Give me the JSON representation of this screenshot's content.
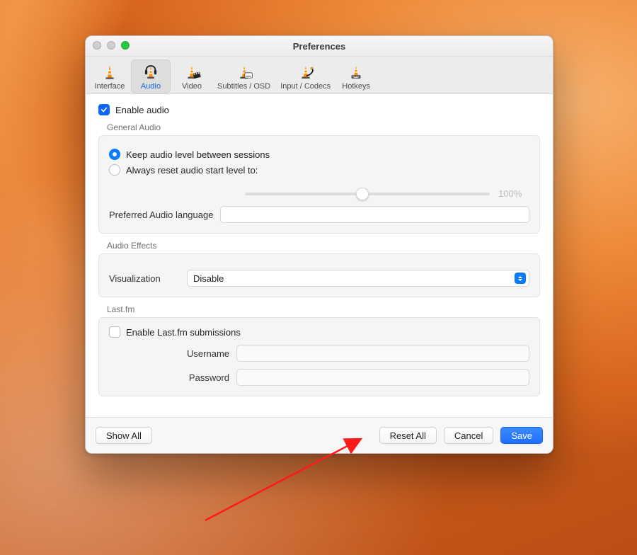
{
  "window": {
    "title": "Preferences"
  },
  "tabs": {
    "interface": "Interface",
    "audio": "Audio",
    "video": "Video",
    "subtitles": "Subtitles / OSD",
    "input": "Input / Codecs",
    "hotkeys": "Hotkeys",
    "selected": "audio"
  },
  "audio": {
    "enable_label": "Enable audio",
    "enable_checked": true,
    "general": {
      "title": "General Audio",
      "radio_keep": "Keep audio level between sessions",
      "radio_reset": "Always reset audio start level to:",
      "radio_selected": "keep",
      "level_percent": "100%",
      "slider_value": 48,
      "pref_lang_label": "Preferred Audio language",
      "pref_lang_value": ""
    },
    "effects": {
      "title": "Audio Effects",
      "visualization_label": "Visualization",
      "visualization_value": "Disable"
    },
    "lastfm": {
      "title": "Last.fm",
      "enable_label": "Enable Last.fm submissions",
      "enable_checked": false,
      "username_label": "Username",
      "username_value": "",
      "password_label": "Password",
      "password_value": ""
    }
  },
  "footer": {
    "show_all": "Show All",
    "reset_all": "Reset All",
    "cancel": "Cancel",
    "save": "Save"
  }
}
